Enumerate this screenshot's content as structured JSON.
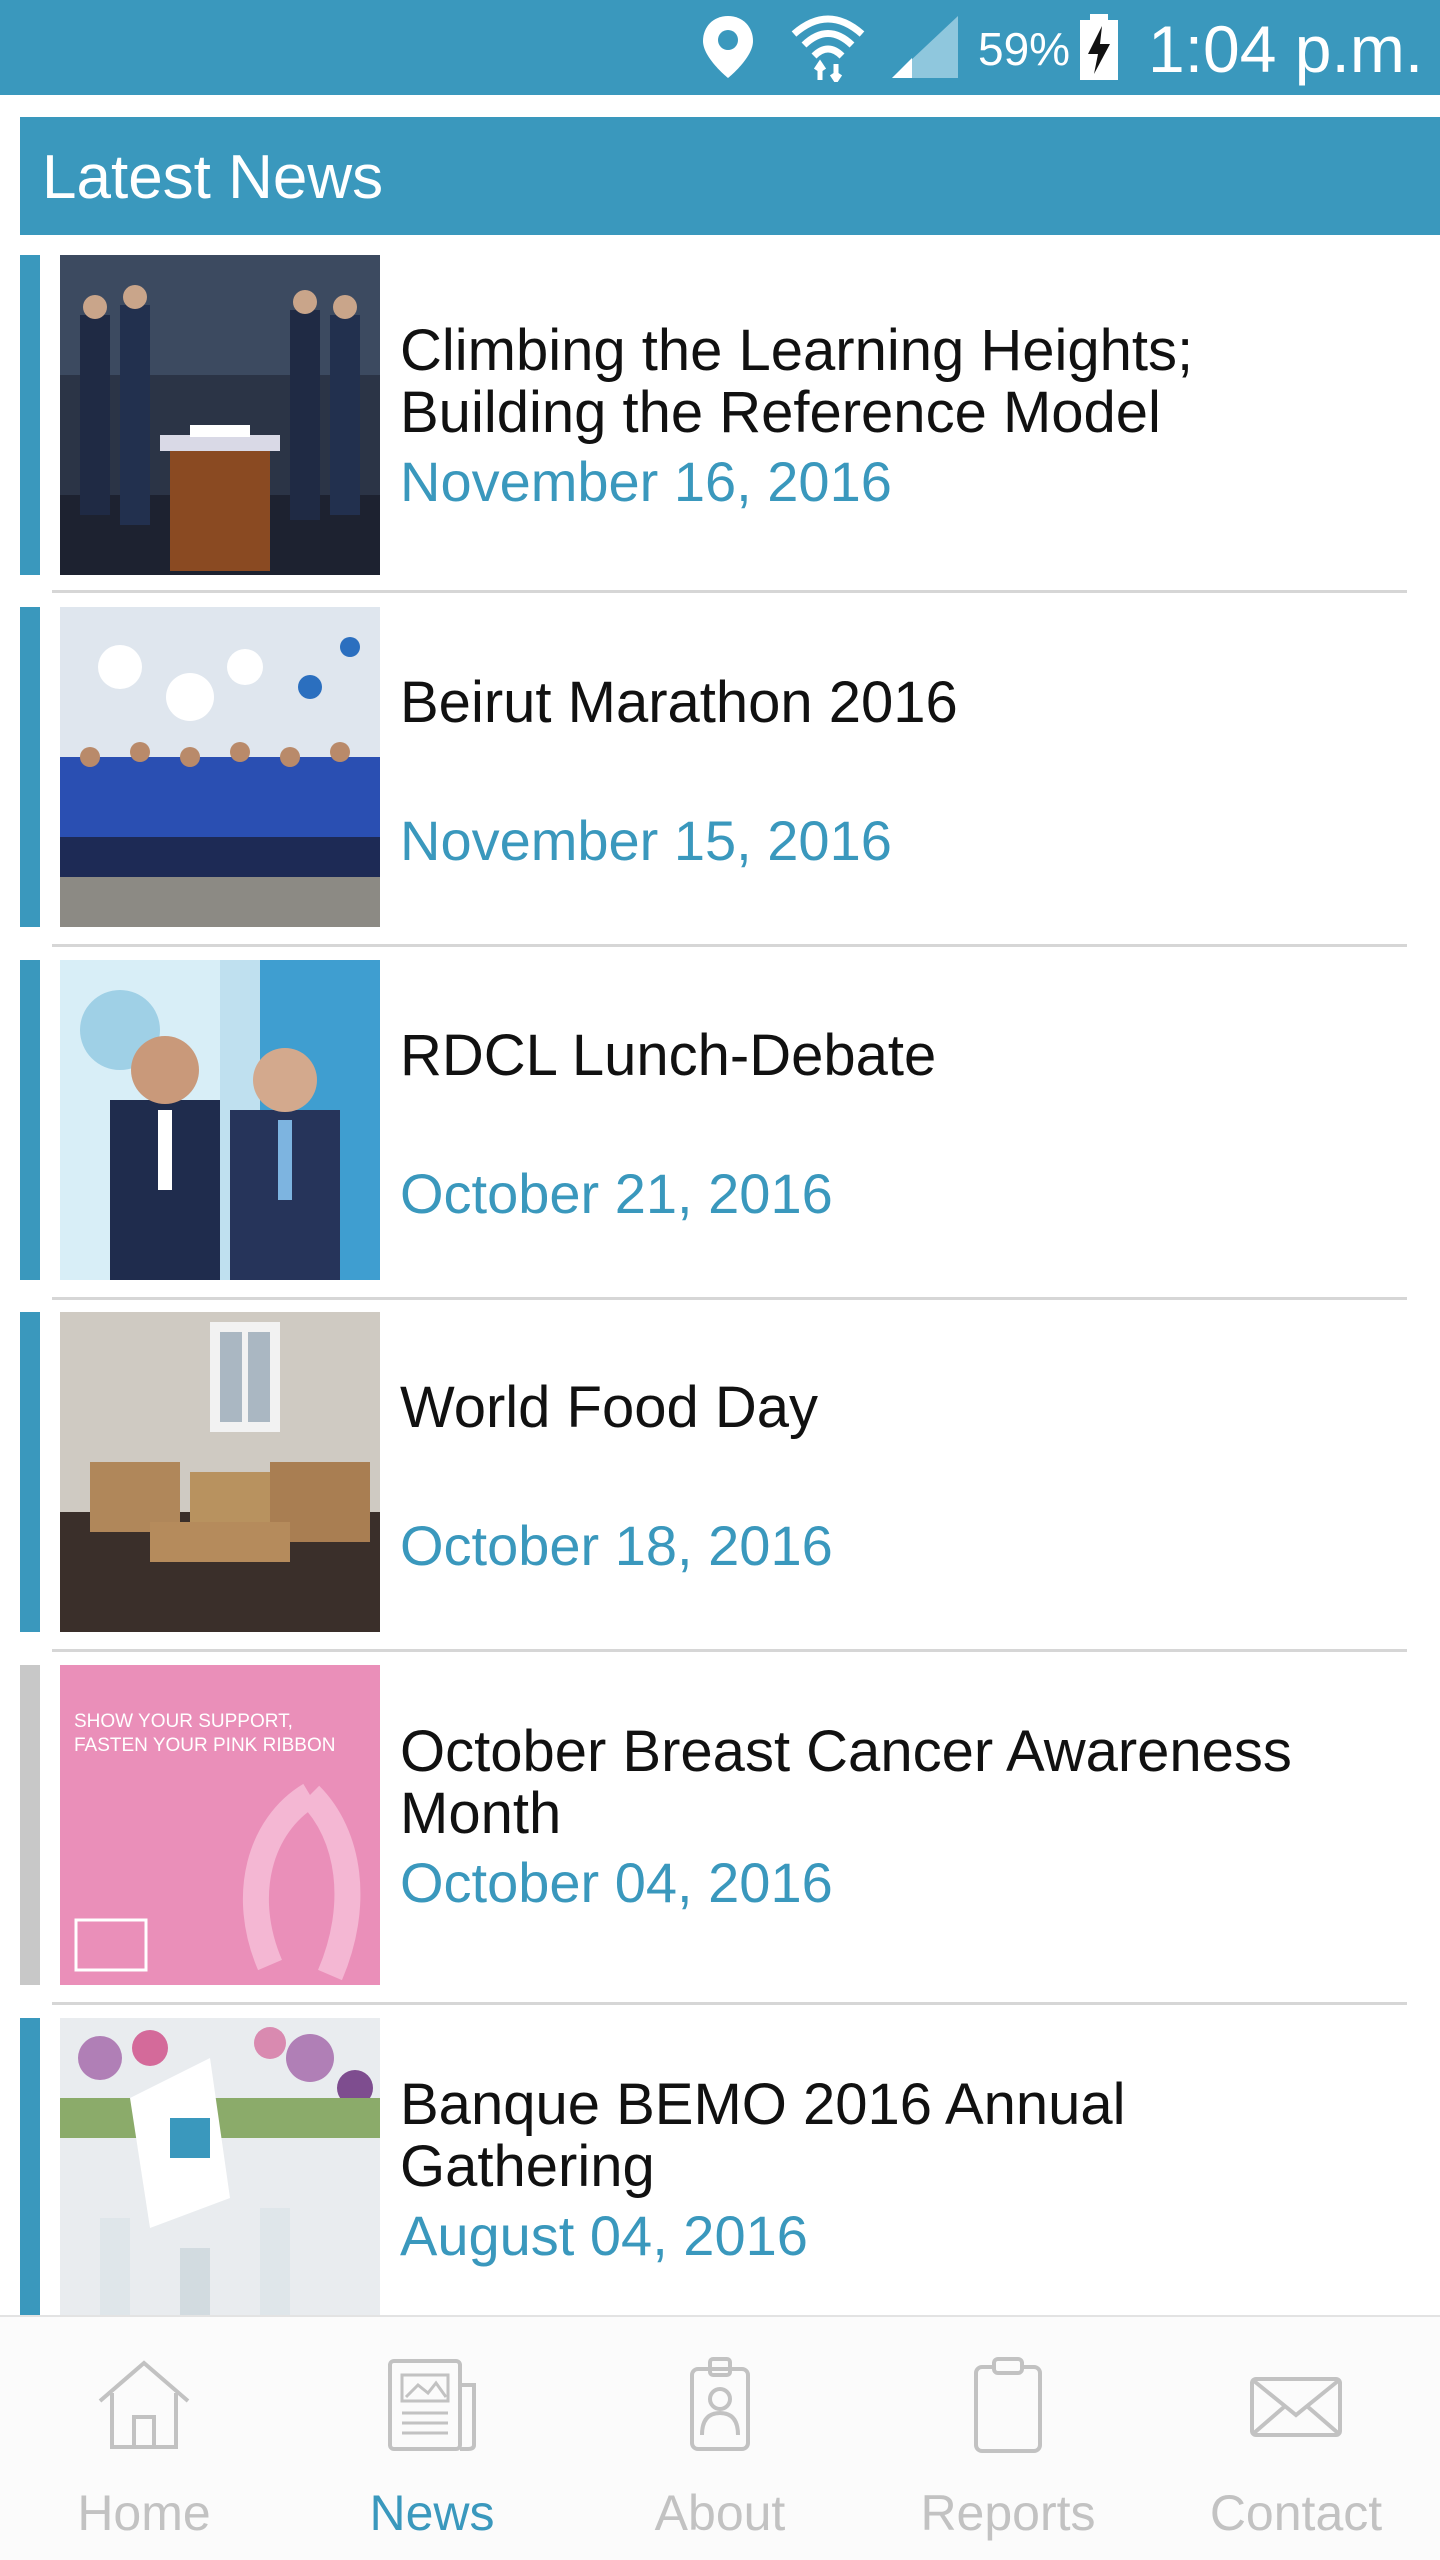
{
  "status_bar": {
    "battery_percent": "59%",
    "time": "1:04 p.m.",
    "icons": [
      "location-icon",
      "wifi-icon",
      "signal-icon",
      "battery-charging-icon"
    ]
  },
  "header": {
    "title": "Latest News"
  },
  "news": [
    {
      "title_line1": "Climbing the Learning Heights;",
      "title_line2": "Building the Reference Model",
      "date": "November 16, 2016",
      "accent": "#3a98bd"
    },
    {
      "title_line1": "Beirut Marathon 2016",
      "title_line2": "",
      "date": "November 15, 2016",
      "accent": "#3a98bd"
    },
    {
      "title_line1": "RDCL Lunch-Debate",
      "title_line2": "",
      "date": "October 21, 2016",
      "accent": "#3a98bd"
    },
    {
      "title_line1": "World Food Day",
      "title_line2": "",
      "date": "October 18, 2016",
      "accent": "#3a98bd"
    },
    {
      "title_line1": "October Breast Cancer Awareness",
      "title_line2": "Month",
      "date": "October 04, 2016",
      "accent": "#c8c8c8"
    },
    {
      "title_line1": "Banque BEMO 2016 Annual",
      "title_line2": "Gathering",
      "date": "August 04, 2016",
      "accent": "#3a98bd"
    }
  ],
  "thumb_text": {
    "pink_line1": "SHOW YOUR SUPPORT,",
    "pink_line2": "FASTEN YOUR PINK RIBBON"
  },
  "bottom_nav": {
    "items": [
      {
        "label": "Home",
        "icon": "home-icon",
        "active": false
      },
      {
        "label": "News",
        "icon": "news-icon",
        "active": true
      },
      {
        "label": "About",
        "icon": "about-icon",
        "active": false
      },
      {
        "label": "Reports",
        "icon": "reports-icon",
        "active": false
      },
      {
        "label": "Contact",
        "icon": "contact-icon",
        "active": false
      }
    ]
  },
  "colors": {
    "primary": "#3a98bd",
    "inactive_nav": "#c2c2c2",
    "text": "#111111"
  }
}
